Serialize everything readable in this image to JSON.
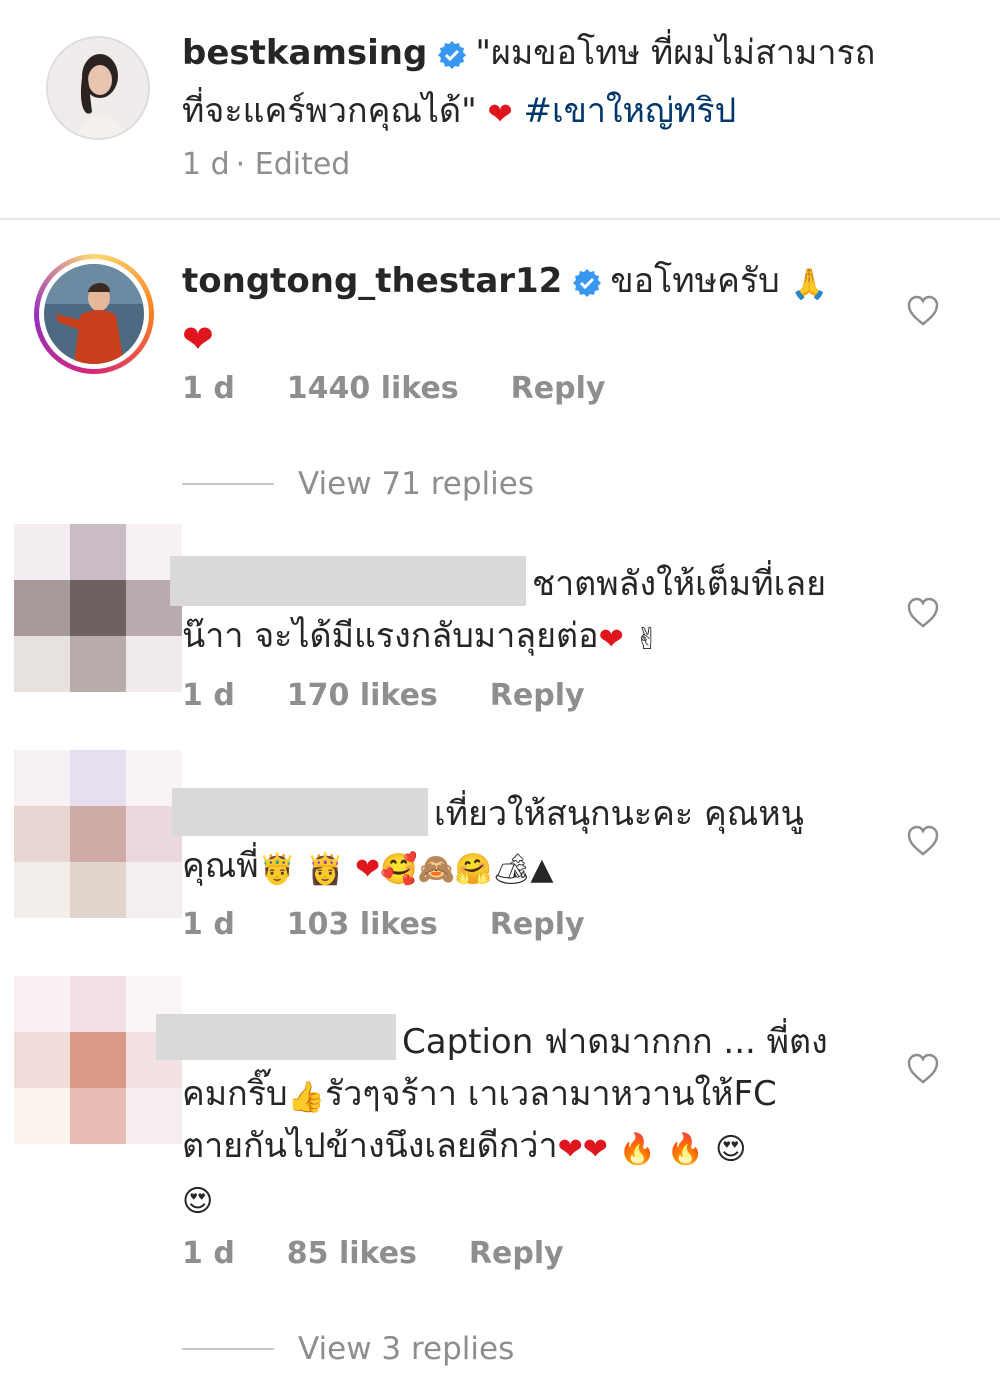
{
  "caption": {
    "username": "bestkamsing",
    "text_line1": "\"ผมขอโทษ ที่ผมไม่สามารถ",
    "text_line2": "ที่จะแคร์พวกคุณได้\"",
    "hashtag": "#เขาใหญ่ทริป",
    "time": "1 d",
    "edited": "· Edited"
  },
  "comments": [
    {
      "username": "tongtong_thestar12",
      "text": "ขอโทษครับ",
      "time": "1 d",
      "likes": "1440 likes",
      "reply": "Reply",
      "view_replies": "View 71 replies"
    },
    {
      "username": "",
      "text_line1": "ชาตพลังให้เต็มที่เลย",
      "text_line2": "น๊าา จะได้มีแรงกลับมาลุยต่อ",
      "time": "1 d",
      "likes": "170 likes",
      "reply": "Reply"
    },
    {
      "username": "",
      "text_line1": "เที่ยวให้สนุกนะคะ คุณหนู",
      "text_line2": "คุณพี่",
      "time": "1 d",
      "likes": "103 likes",
      "reply": "Reply"
    },
    {
      "username": "",
      "text_line1": "Caption ฟาดมากกก ... พี่ตง",
      "text_line2": "คมกริ๊บ",
      "text_line2b": "รัวๆจร้าา เาเวลามาหวานให้FC",
      "text_line3": "ตายกันไปข้างนึงเลยดีกว่า",
      "time": "1 d",
      "likes": "85 likes",
      "reply": "Reply",
      "view_replies": "View 3 replies"
    }
  ],
  "icons": {
    "verified": "verified-badge-icon",
    "heart": "heart-outline-icon",
    "red_heart": "red-heart-emoji"
  },
  "colors": {
    "verified": "#3897f0",
    "hashtag": "#00376b",
    "meta": "#8e8e8e",
    "heart": "#e0161e"
  }
}
